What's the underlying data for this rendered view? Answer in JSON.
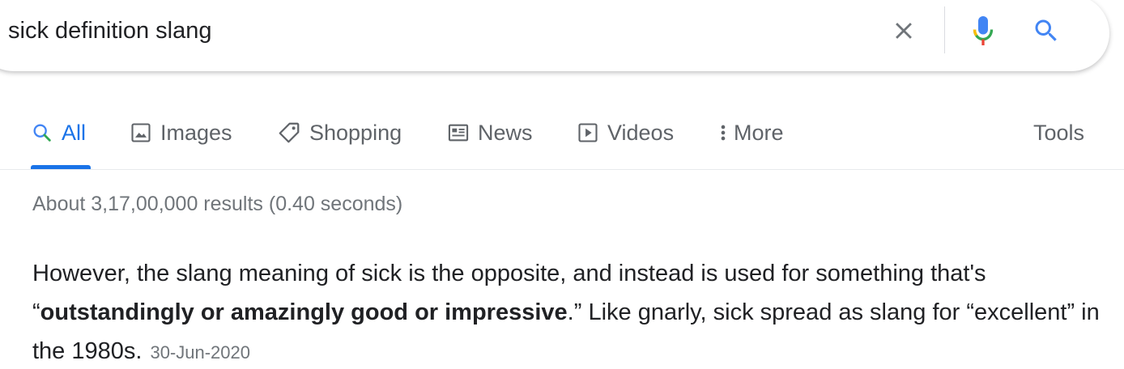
{
  "search": {
    "query": "sick definition slang",
    "clear_icon": "close-icon",
    "mic_icon": "mic-icon",
    "search_icon": "search-icon"
  },
  "tabs": [
    {
      "label": "All",
      "icon": "search-icon",
      "active": true
    },
    {
      "label": "Images",
      "icon": "image-icon"
    },
    {
      "label": "Shopping",
      "icon": "tag-icon"
    },
    {
      "label": "News",
      "icon": "newspaper-icon"
    },
    {
      "label": "Videos",
      "icon": "play-icon"
    },
    {
      "label": "More",
      "icon": "more-vert-icon"
    }
  ],
  "tools_label": "Tools",
  "result_stats": "About 3,17,00,000 results (0.40 seconds)",
  "snippet": {
    "part1": "However, the slang meaning of sick is the opposite, and instead is used for something that's “",
    "bold": "outstandingly or amazingly good or impressive",
    "part2": ".” Like gnarly, sick spread as slang for “excellent” in the 1980s.",
    "date": "30-Jun-2020"
  },
  "colors": {
    "accent": "#1a73e8",
    "text": "#202124",
    "muted": "#70757a",
    "tab_gray": "#5f6368"
  }
}
